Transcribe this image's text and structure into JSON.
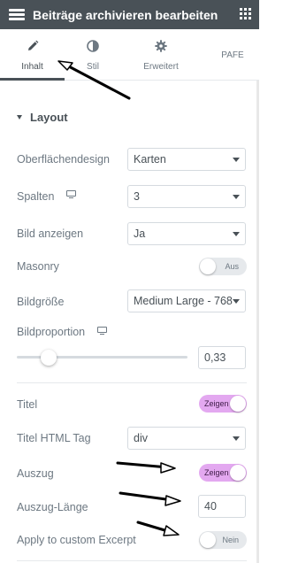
{
  "header": {
    "title": "Beiträge archivieren bearbeiten",
    "menu_icon": "hamburger-icon",
    "grid_icon": "apps-grid-icon",
    "background": "#495157"
  },
  "tabs": [
    {
      "label": "Inhalt",
      "icon": "pencil-icon",
      "active": true
    },
    {
      "label": "Stil",
      "icon": "contrast-icon",
      "active": false
    },
    {
      "label": "Erweitert",
      "icon": "gear-icon",
      "active": false
    },
    {
      "label": "PAFE",
      "icon": "",
      "active": false
    }
  ],
  "section": {
    "title": "Layout"
  },
  "controls": {
    "oberflaechendesign": {
      "label": "Oberflächendesign",
      "value": "Karten"
    },
    "spalten": {
      "label": "Spalten",
      "value": "3"
    },
    "bild_anzeigen": {
      "label": "Bild anzeigen",
      "value": "Ja"
    },
    "masonry": {
      "label": "Masonry",
      "state": "Aus"
    },
    "bildgroesse": {
      "label": "Bildgröße",
      "value": "Medium Large - 768"
    },
    "bildproportion": {
      "label": "Bildproportion",
      "value": "0,33",
      "slider_fraction": 0.33
    },
    "titel": {
      "label": "Titel",
      "state": "Zeigen"
    },
    "titel_html_tag": {
      "label": "Titel HTML Tag",
      "value": "div"
    },
    "auszug": {
      "label": "Auszug",
      "state": "Zeigen"
    },
    "auszug_laenge": {
      "label": "Auszug-Länge",
      "value": "40"
    },
    "apply_custom_excerpt": {
      "label": "Apply to custom Excerpt",
      "state": "Nein"
    }
  },
  "colors": {
    "toggle_on": "#e3a8f0",
    "toggle_off": "#e6e9ec",
    "annotation_arrows": "#000000"
  }
}
